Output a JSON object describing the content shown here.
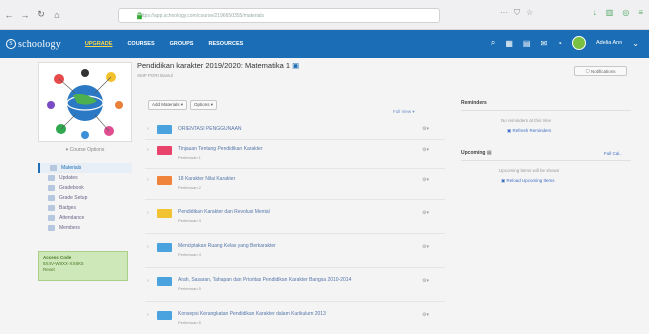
{
  "browser": {
    "url": "https://app.schoology.com/course/2196650355/materials"
  },
  "header": {
    "logo_text": "schoology",
    "upgrade": "UPGRADE",
    "nav": [
      "COURSES",
      "GROUPS",
      "RESOURCES"
    ],
    "user": "Adelia Ann"
  },
  "sidebar": {
    "course_options": "Course Options",
    "menu": [
      {
        "label": "Materials",
        "icon": "folder-icon"
      },
      {
        "label": "Updates",
        "icon": "updates-icon"
      },
      {
        "label": "Gradebook",
        "icon": "gradebook-icon"
      },
      {
        "label": "Grade Setup",
        "icon": "grade-setup-icon"
      },
      {
        "label": "Badges",
        "icon": "badge-icon"
      },
      {
        "label": "Attendance",
        "icon": "attendance-icon"
      },
      {
        "label": "Members",
        "icon": "members-icon"
      }
    ],
    "access_code_label": "Access Code",
    "access_code": "8X4V-W8XX-XX8K5",
    "access_reset": "Reset"
  },
  "main": {
    "title": "Pendidikan karakter 2019/2020: Matematika 1",
    "subtitle": "SMP PGRI Bantul",
    "add_materials": "Add Materials ▾",
    "options": "Options ▾",
    "full_view": "Full View ▾",
    "folders": [
      {
        "title": "ORIENTASI PENGGUNAAN",
        "sub": "",
        "color": "#4aa3df"
      },
      {
        "title": "Tinjauan Tentang Pendidikan Karakter",
        "sub": "Pertemuan 1",
        "color": "#e8436b"
      },
      {
        "title": "18 Karakter Nilai Karakter",
        "sub": "Pertemuan 2",
        "color": "#f0843a"
      },
      {
        "title": "Pendidikan Karakter dan Revolusi Mental",
        "sub": "Pertemuan 3",
        "color": "#f1c232"
      },
      {
        "title": "Menciptakan Ruang Kelas yang Berkarakter",
        "sub": "Pertemuan 4",
        "color": "#4aa3df"
      },
      {
        "title": "Arah, Sasaran, Tahapan dan Prioritas Pendidikan Karakter Bangsa 2010-2014",
        "sub": "Pertemuan 5",
        "color": "#4aa3df"
      },
      {
        "title": "Konsepsi Kerangkatan Pendidikan Karakter dalam Kurikulum 2013",
        "sub": "Pertemuan 6",
        "color": "#4aa3df"
      }
    ]
  },
  "right": {
    "notifications": "Notifications",
    "reminders_head": "Reminders",
    "reminders_empty": "No reminders at this time",
    "refresh": "Refresh Reminders",
    "upcoming_head": "Upcoming",
    "upcoming_link": "Full Cal..",
    "upcoming_empty": "Upcoming items will be shown",
    "reload": "Reload Upcoming Items"
  }
}
